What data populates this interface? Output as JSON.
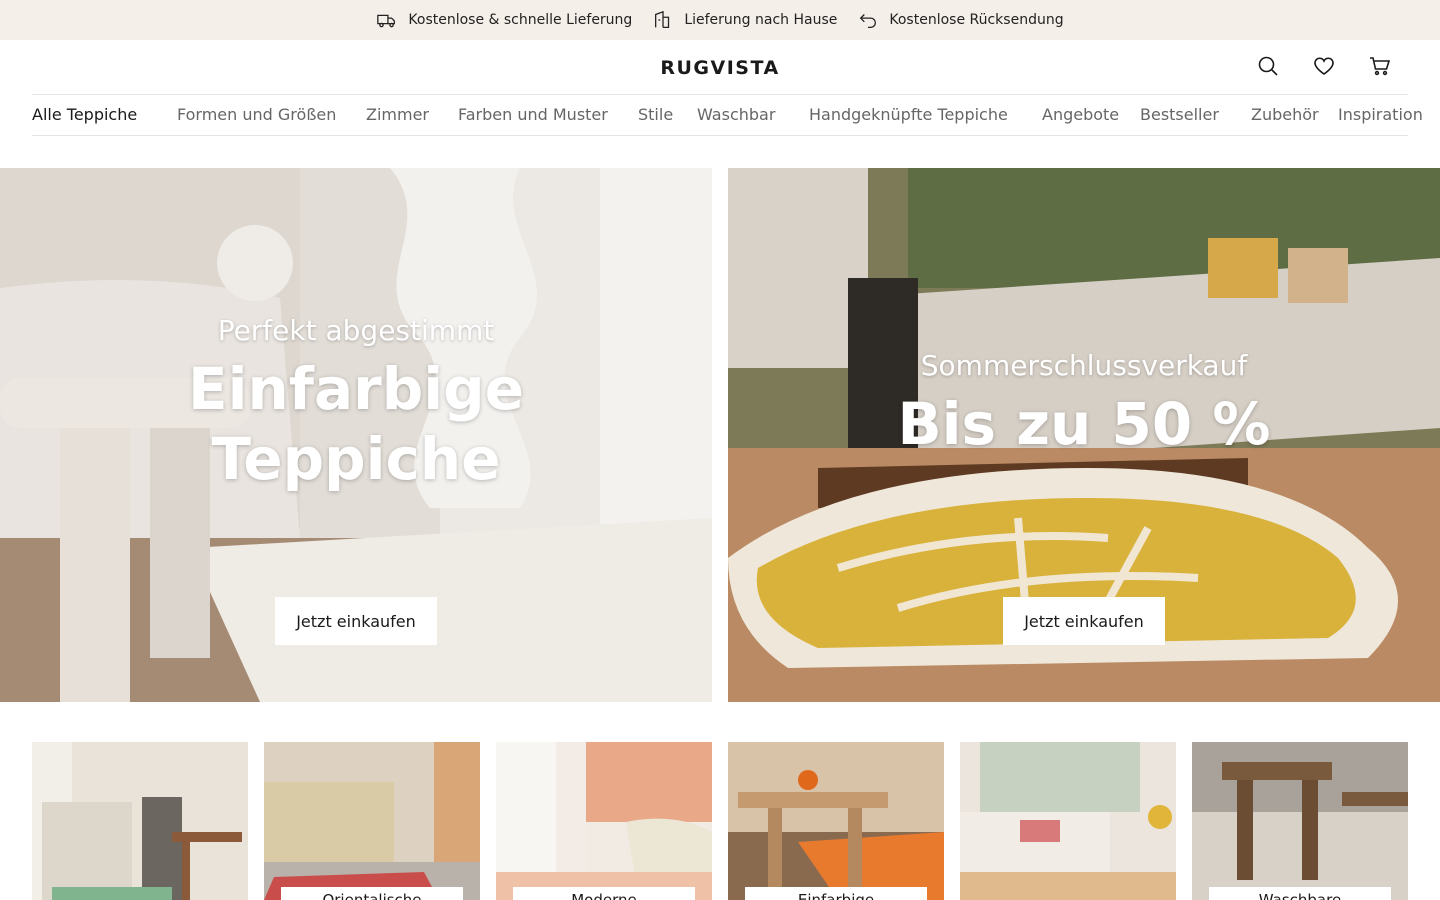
{
  "topbar": {
    "benefits": [
      {
        "icon": "truck-icon",
        "text": "Kostenlose & schnelle Lieferung"
      },
      {
        "icon": "home-delivery-icon",
        "text": "Lieferung nach Hause"
      },
      {
        "icon": "return-icon",
        "text": "Kostenlose Rücksendung"
      }
    ]
  },
  "header": {
    "logo": "RUGVISTA",
    "icons": [
      "search-icon",
      "heart-icon",
      "cart-icon"
    ]
  },
  "nav": {
    "items": [
      {
        "label": "Alle Teppiche"
      },
      {
        "label": "Formen und Größen"
      },
      {
        "label": "Zimmer"
      },
      {
        "label": "Farben und Muster"
      },
      {
        "label": "Stile"
      },
      {
        "label": "Waschbar"
      },
      {
        "label": "Handgeknüpfte Teppiche"
      },
      {
        "label": "Angebote"
      },
      {
        "label": "Bestseller"
      },
      {
        "label": "Zubehör"
      },
      {
        "label": "Inspiration"
      }
    ]
  },
  "hero": {
    "left": {
      "kicker": "Perfekt abgestimmt",
      "headline_line1": "Einfarbige",
      "headline_line2": "Teppiche",
      "cta": "Jetzt einkaufen"
    },
    "right": {
      "kicker": "Sommerschlussverkauf",
      "headline": "Bis zu 50 %",
      "cta": "Jetzt einkaufen"
    }
  },
  "tiles": [
    {
      "label": ""
    },
    {
      "label": "Orientalische"
    },
    {
      "label": "Moderne"
    },
    {
      "label": "Einfarbige"
    },
    {
      "label": ""
    },
    {
      "label": "Waschbare"
    }
  ]
}
